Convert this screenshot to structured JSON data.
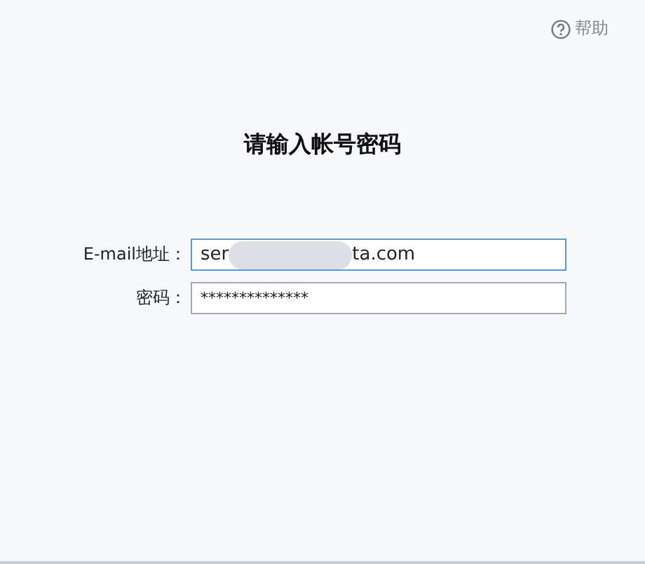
{
  "help": {
    "label": "帮助"
  },
  "title": "请输入帐号密码",
  "fields": [
    {
      "kind": "email",
      "label": "E-mail地址：",
      "value_start": "ser",
      "value_end": "ta.com",
      "redacted": true,
      "focused": true
    },
    {
      "kind": "password",
      "label": "密码：",
      "value": "**************",
      "focused": false
    }
  ]
}
